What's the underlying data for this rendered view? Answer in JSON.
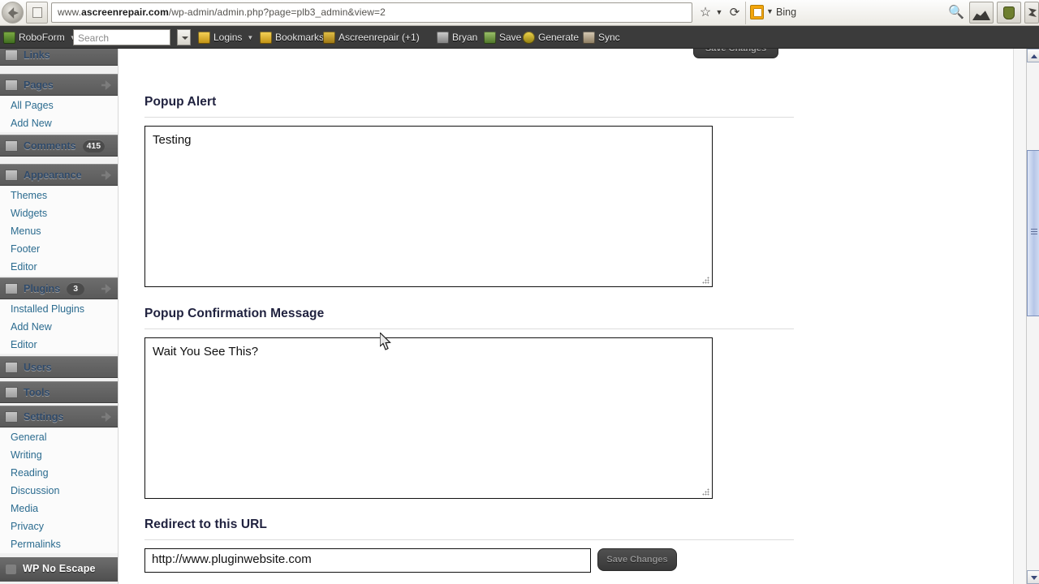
{
  "browser": {
    "back_icon": "back-arrow-icon",
    "forward_icon": "forward-arrow-icon",
    "url_prefix": "www.",
    "url_domain": "ascreenrepair.com",
    "url_path": "/wp-admin/admin.php?page=plb3_admin&view=2",
    "bookmark_star": "☆",
    "bookmark_caret": "▼",
    "reload_glyph": "⟳",
    "search_engine": "Bing",
    "search_engine_caret": "▼",
    "search_go_glyph": "🔍",
    "tray_icon_1": "mountain-photo-icon",
    "tray_icon_2": "turtle-icon",
    "tray_icon_3": "bug-icon"
  },
  "roboform": {
    "brand": "RoboForm",
    "brand_caret": "▼",
    "search_placeholder": "Search",
    "items": [
      {
        "label": "Logins",
        "caret": "▼"
      },
      {
        "label": "Bookmarks",
        "caret": "▼"
      },
      {
        "label": "Ascreenrepair (+1)",
        "caret": ""
      },
      {
        "label": "Bryan",
        "caret": ""
      },
      {
        "label": "Save",
        "caret": ""
      },
      {
        "label": "Generate",
        "caret": ""
      },
      {
        "label": "Sync",
        "caret": ""
      }
    ]
  },
  "sidebar": {
    "groups": [
      {
        "label": "Links",
        "icon": "link-icon",
        "badge": "",
        "arrow": false,
        "children": []
      },
      {
        "label": "Pages",
        "icon": "page-icon",
        "badge": "",
        "arrow": true,
        "children": [
          "All Pages",
          "Add New"
        ]
      },
      {
        "label": "Comments",
        "icon": "comment-icon",
        "badge": "415",
        "arrow": false,
        "children": []
      },
      {
        "label": "Appearance",
        "icon": "appearance-icon",
        "badge": "",
        "arrow": true,
        "children": [
          "Themes",
          "Widgets",
          "Menus",
          "Footer",
          "Editor"
        ]
      },
      {
        "label": "Plugins",
        "icon": "plug-icon",
        "badge": "3",
        "arrow": true,
        "children": [
          "Installed Plugins",
          "Add New",
          "Editor"
        ]
      },
      {
        "label": "Users",
        "icon": "users-icon",
        "badge": "",
        "arrow": false,
        "children": []
      },
      {
        "label": "Tools",
        "icon": "tools-icon",
        "badge": "",
        "arrow": false,
        "children": []
      },
      {
        "label": "Settings",
        "icon": "settings-icon",
        "badge": "",
        "arrow": true,
        "children": [
          "General",
          "Writing",
          "Reading",
          "Discussion",
          "Media",
          "Privacy",
          "Permalinks"
        ]
      }
    ],
    "current_item": "WP No Escape"
  },
  "main": {
    "save_top_label": "Save Changes",
    "sections": [
      {
        "id": "popup-alert",
        "title": "Popup Alert",
        "value": "Testing"
      },
      {
        "id": "popup-confirm",
        "title": "Popup Confirmation Message",
        "value": "Wait You See This?"
      }
    ],
    "redirect": {
      "title": "Redirect to this URL",
      "value": "http://www.pluginwebsite.com",
      "save_label": "Save Changes"
    }
  },
  "scrollbar": {
    "up_arrow": "scroll-up-arrow-icon",
    "down_arrow": "scroll-down-arrow-icon"
  },
  "colors": {
    "heading": "#20223f",
    "sidebar_link": "#2b6b8f",
    "toolbar_bg": "#3b3b3b",
    "save_button": "#383838"
  }
}
